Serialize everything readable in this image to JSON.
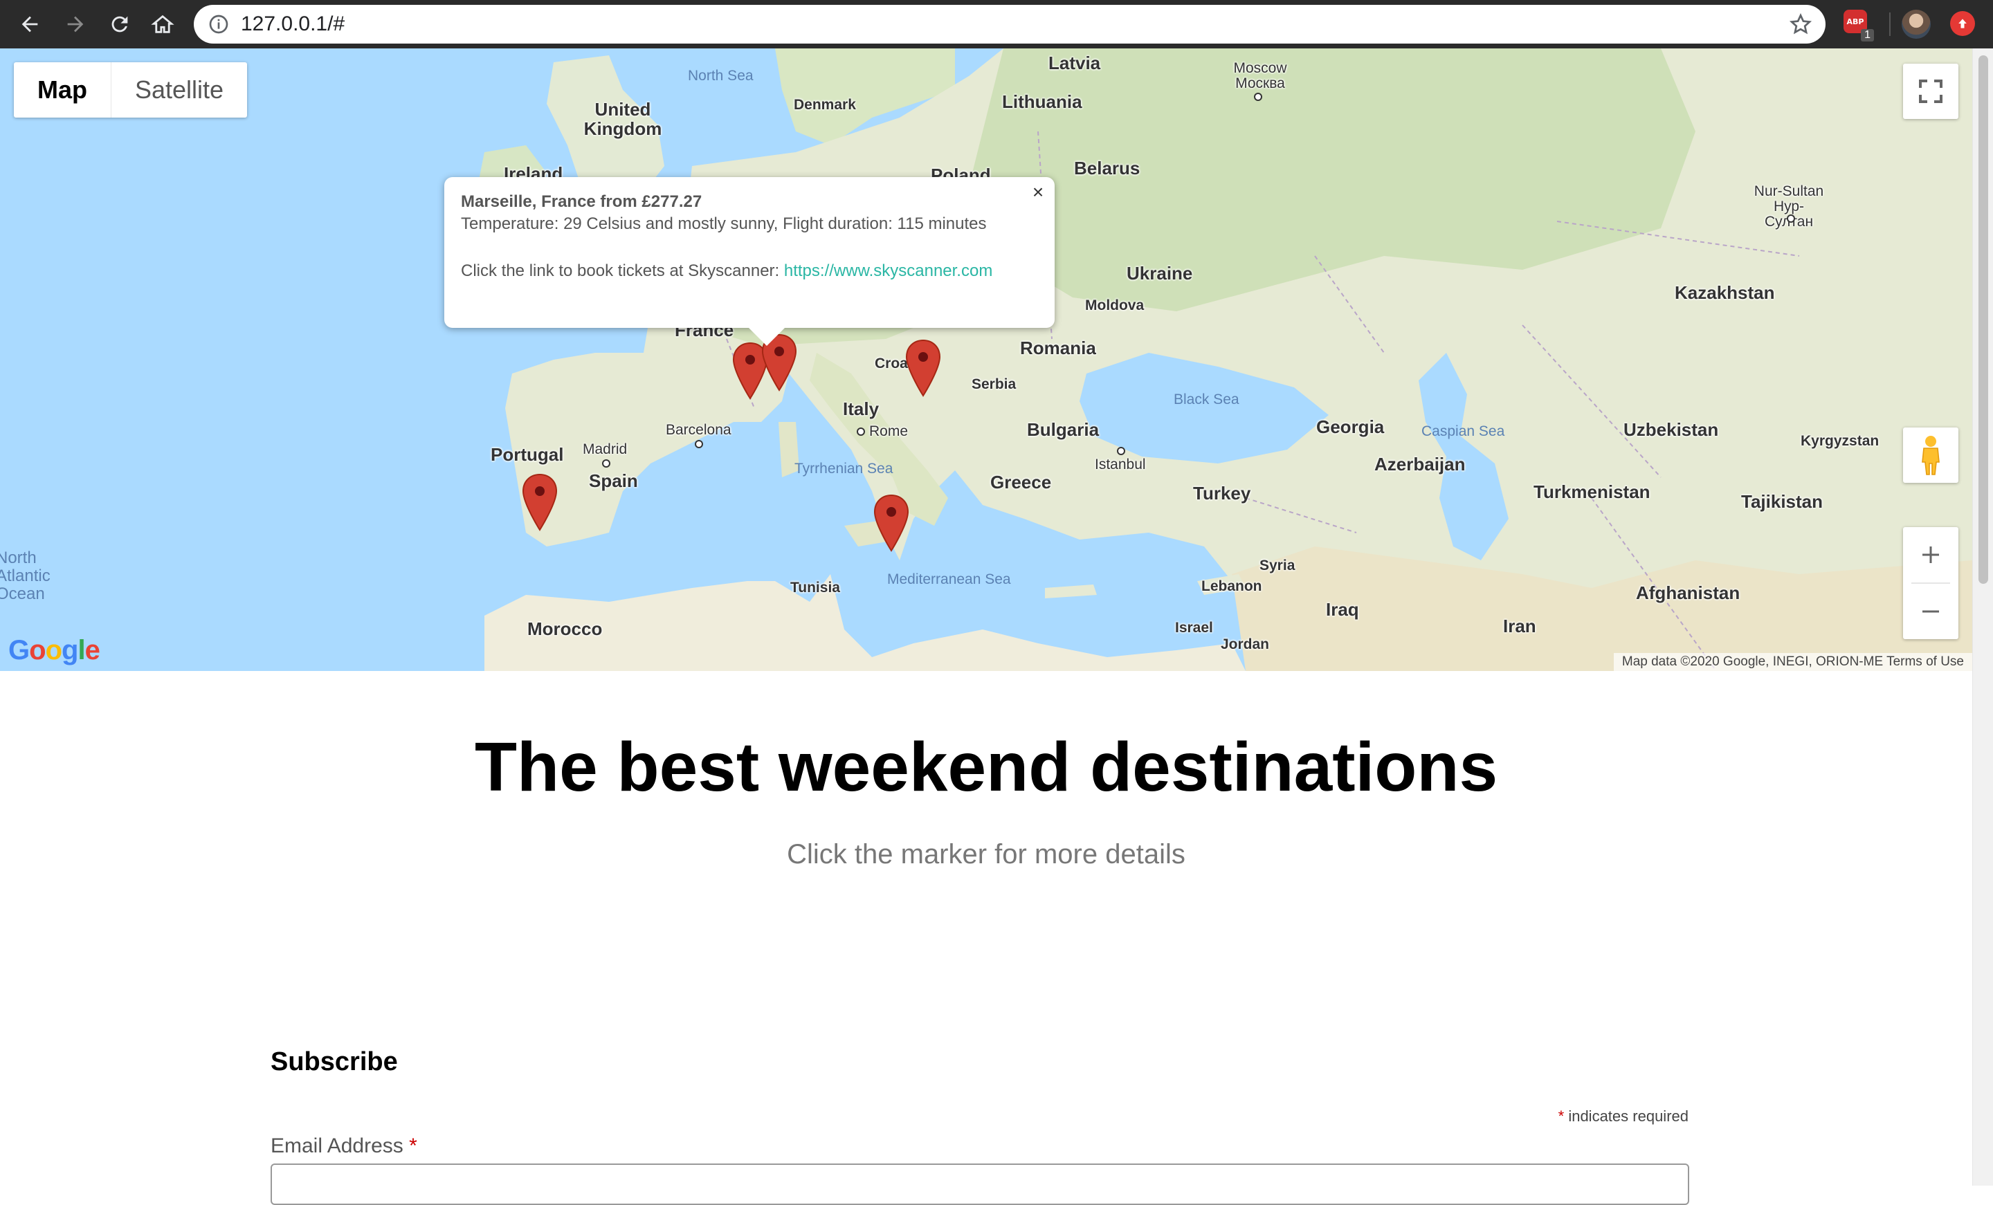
{
  "browser": {
    "url": "127.0.0.1/#"
  },
  "map": {
    "type_controls": {
      "map_label": "Map",
      "satellite_label": "Satellite"
    },
    "attribution": "Map data ©2020 Google, INEGI, ORION-ME  Terms of Use",
    "logo_text": "Google",
    "countries": [
      "Latvia",
      "Lithuania",
      "Belarus",
      "Poland",
      "United Kingdom",
      "Ireland",
      "Denmark",
      "Ukraine",
      "Moldova",
      "Romania",
      "Serbia",
      "Croa",
      "Bulgaria",
      "Italy",
      "France",
      "Spain",
      "Portugal",
      "Greece",
      "Turkey",
      "Georgia",
      "Azerbaijan",
      "Kazakhstan",
      "Uzbekistan",
      "Kyrgyzstan",
      "Turkmenistan",
      "Tajikistan",
      "Afghanistan",
      "Iran",
      "Iraq",
      "Syria",
      "Lebanon",
      "Israel",
      "Jordan",
      "Tunisia",
      "Morocco"
    ],
    "cities": [
      "Moscow Москва",
      "Nur-Sultan Нур-Султан",
      "Madrid",
      "Barcelona",
      "Rome",
      "Istanbul"
    ],
    "seas": [
      "North Sea",
      "Black Sea",
      "Caspian Sea",
      "Tyrrhenian Sea",
      "Mediterranean Sea",
      "North Atlantic Ocean"
    ],
    "markers": [
      "Marseille",
      "Nice",
      "Split",
      "Malta",
      "Lisbon"
    ],
    "info_window": {
      "title": "Marseille, France from £277.27",
      "details": "Temperature: 29 Celsius and mostly sunny, Flight duration: 115 minutes",
      "book_text": "Click the link to book tickets at Skyscanner: ",
      "link_text": "https://www.skyscanner.com",
      "close_icon": "×"
    }
  },
  "page": {
    "title": "The best weekend destinations",
    "subtitle": "Click the marker for more details"
  },
  "subscribe": {
    "title": "Subscribe",
    "required_note": "indicates required",
    "asterisk": "*",
    "email_label": "Email Address",
    "email_value": ""
  },
  "icons": [
    "back-icon",
    "forward-icon",
    "reload-icon",
    "home-icon",
    "info-icon",
    "star-icon",
    "fullscreen-icon",
    "pegman-icon",
    "zoom-in-icon",
    "zoom-out-icon",
    "close-icon",
    "marker-icon"
  ],
  "colors": {
    "water": "#aadaff",
    "land": "#e8e8d8",
    "marker": "#d23f31",
    "link": "#2ab6a4"
  }
}
